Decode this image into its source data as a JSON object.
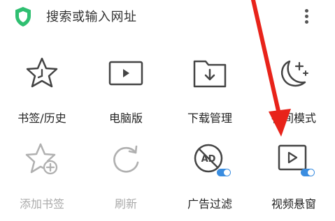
{
  "topbar": {
    "search_placeholder": "搜索或输入网址"
  },
  "tiles": [
    {
      "id": "bookmarks-history",
      "label": "书签/历史",
      "icon": "star-clock-icon",
      "enabled": true
    },
    {
      "id": "desktop-version",
      "label": "电脑版",
      "icon": "monitor-icon",
      "enabled": true
    },
    {
      "id": "download-manager",
      "label": "下载管理",
      "icon": "download-folder-icon",
      "enabled": true
    },
    {
      "id": "night-mode",
      "label": "夜间模式",
      "icon": "moon-stars-icon",
      "enabled": true
    },
    {
      "id": "add-bookmark",
      "label": "添加书签",
      "icon": "star-plus-icon",
      "enabled": false
    },
    {
      "id": "refresh",
      "label": "刷新",
      "icon": "refresh-icon",
      "enabled": false
    },
    {
      "id": "ad-filter",
      "label": "广告过滤",
      "icon": "ad-block-icon",
      "enabled": true,
      "toggle_on": true
    },
    {
      "id": "video-float",
      "label": "视频悬窗",
      "icon": "video-window-icon",
      "enabled": true,
      "toggle_on": true
    }
  ],
  "colors": {
    "accent": "#3a8de0",
    "shield": "#2fbf71",
    "arrow": "#e8231a",
    "icon": "#444444",
    "icon_disabled": "#b0b0b0"
  }
}
